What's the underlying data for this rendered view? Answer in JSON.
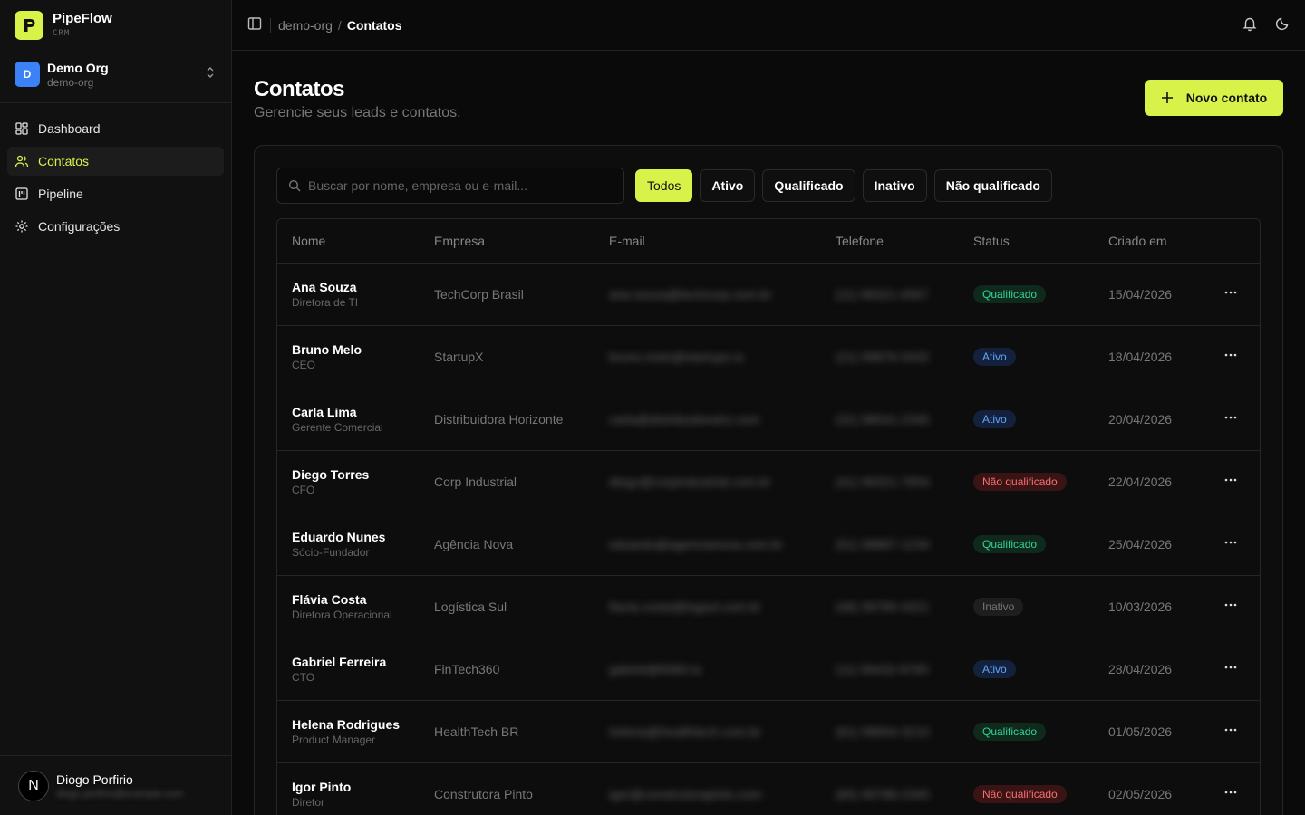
{
  "brand": {
    "name": "PipeFlow",
    "sub": "CRM"
  },
  "org": {
    "initial": "D",
    "name": "Demo Org",
    "slug": "demo-org"
  },
  "nav": [
    {
      "label": "Dashboard",
      "icon": "dashboard-icon"
    },
    {
      "label": "Contatos",
      "icon": "users-icon",
      "active": true
    },
    {
      "label": "Pipeline",
      "icon": "kanban-icon"
    },
    {
      "label": "Configurações",
      "icon": "gear-icon"
    }
  ],
  "user": {
    "initial": "N",
    "name": "Diogo Porfirio",
    "email": "diogo.porfirio@example.com"
  },
  "breadcrumb": {
    "org": "demo-org",
    "separator": "/",
    "current": "Contatos"
  },
  "page": {
    "title": "Contatos",
    "subtitle": "Gerencie seus leads e contatos.",
    "new_button": "Novo contato",
    "search_placeholder": "Buscar por nome, empresa ou e-mail..."
  },
  "filters": [
    "Todos",
    "Ativo",
    "Qualificado",
    "Inativo",
    "Não qualificado"
  ],
  "columns": [
    "Nome",
    "Empresa",
    "E-mail",
    "Telefone",
    "Status",
    "Criado em"
  ],
  "rows": [
    {
      "name": "Ana Souza",
      "role": "Diretora de TI",
      "company": "TechCorp Brasil",
      "email": "ana.souza@techcorp.com.br",
      "phone": "(11) 98321-4567",
      "status": "Qualificado",
      "created": "15/04/2026"
    },
    {
      "name": "Bruno Melo",
      "role": "CEO",
      "company": "StartupX",
      "email": "bruno.melo@startupx.io",
      "phone": "(21) 99876-5432",
      "status": "Ativo",
      "created": "18/04/2026"
    },
    {
      "name": "Carla Lima",
      "role": "Gerente Comercial",
      "company": "Distribuidora Horizonte",
      "email": "carla@distribuidorahz.com",
      "phone": "(31) 98541-2345",
      "status": "Ativo",
      "created": "20/04/2026"
    },
    {
      "name": "Diego Torres",
      "role": "CFO",
      "company": "Corp Industrial",
      "email": "diego@corpindustrial.com.br",
      "phone": "(41) 99321-7654",
      "status": "Não qualificado",
      "created": "22/04/2026"
    },
    {
      "name": "Eduardo Nunes",
      "role": "Sócio-Fundador",
      "company": "Agência Nova",
      "email": "eduardo@agencianova.com.br",
      "phone": "(51) 98887-1234",
      "status": "Qualificado",
      "created": "25/04/2026"
    },
    {
      "name": "Flávia Costa",
      "role": "Diretora Operacional",
      "company": "Logística Sul",
      "email": "flavia.costa@logsul.com.br",
      "phone": "(48) 99765-4321",
      "status": "Inativo",
      "created": "10/03/2026"
    },
    {
      "name": "Gabriel Ferreira",
      "role": "CTO",
      "company": "FinTech360",
      "email": "gabriel@ft360.io",
      "phone": "(11) 99432-8765",
      "status": "Ativo",
      "created": "28/04/2026"
    },
    {
      "name": "Helena Rodrigues",
      "role": "Product Manager",
      "company": "HealthTech BR",
      "email": "helena@healthtech.com.br",
      "phone": "(61) 98654-3210",
      "status": "Qualificado",
      "created": "01/05/2026"
    },
    {
      "name": "Igor Pinto",
      "role": "Diretor",
      "company": "Construtora Pinto",
      "email": "igor@construtorapinto.com",
      "phone": "(85) 99788-2345",
      "status": "Não qualificado",
      "created": "02/05/2026"
    }
  ],
  "colors": {
    "accent": "#d9f24a",
    "background": "#0a0a0a",
    "sidebar": "#111111"
  }
}
